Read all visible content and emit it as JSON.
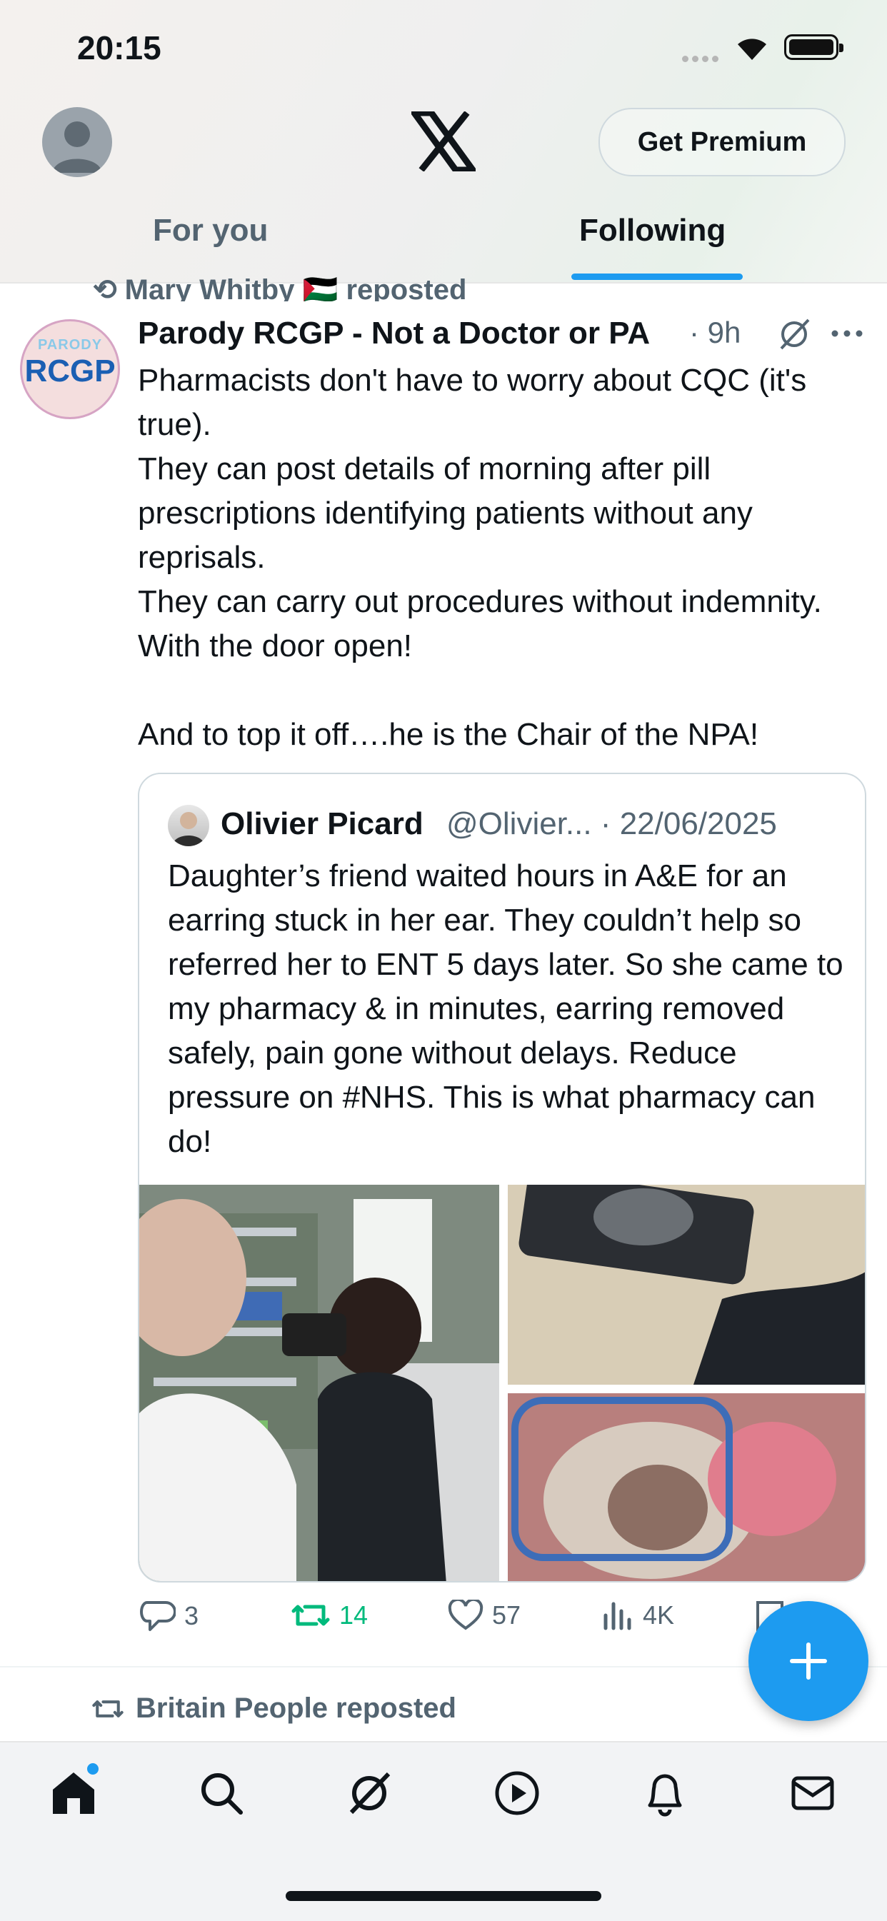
{
  "status_bar": {
    "time": "20:15"
  },
  "header": {
    "premium_label": "Get Premium",
    "tabs": [
      {
        "label": "For you"
      },
      {
        "label": "Following"
      }
    ],
    "active_tab": "Following",
    "accent": "#1d9bf0"
  },
  "post": {
    "repost_by": "Mary Whitby 🇵🇸 reposted",
    "avatar_text_top": "PARODY",
    "avatar_text_main": "RCGP",
    "author": "Parody RCGP - Not a Doctor or PA",
    "time": "· 9h",
    "text": "Pharmacists don't have to worry about CQC (it's true).\nThey can post details of morning after pill prescriptions identifying patients without any reprisals.\nThey can carry out procedures without indemnity. With the door open!\n\nAnd to top it off….he is the Chair of the NPA!",
    "quote": {
      "author": "Olivier Picard",
      "handle_date": "@Olivier... · 22/06/2025",
      "text": "Daughter’s friend waited hours in A&E for an earring stuck in her ear. They couldn’t help so referred her to ENT 5 days later. So she came to my pharmacy & in minutes, earring removed safely, pain gone without delays. Reduce pressure on #NHS. This is what pharmacy can do!"
    },
    "actions": {
      "replies": "3",
      "reposts": "14",
      "likes": "57",
      "views": "4K"
    }
  },
  "next_post": {
    "repost_by": "Britain People reposted"
  },
  "bottom_nav": [
    "home-icon",
    "search-icon",
    "grok-icon",
    "video-icon",
    "notifications-icon",
    "messages-icon"
  ]
}
